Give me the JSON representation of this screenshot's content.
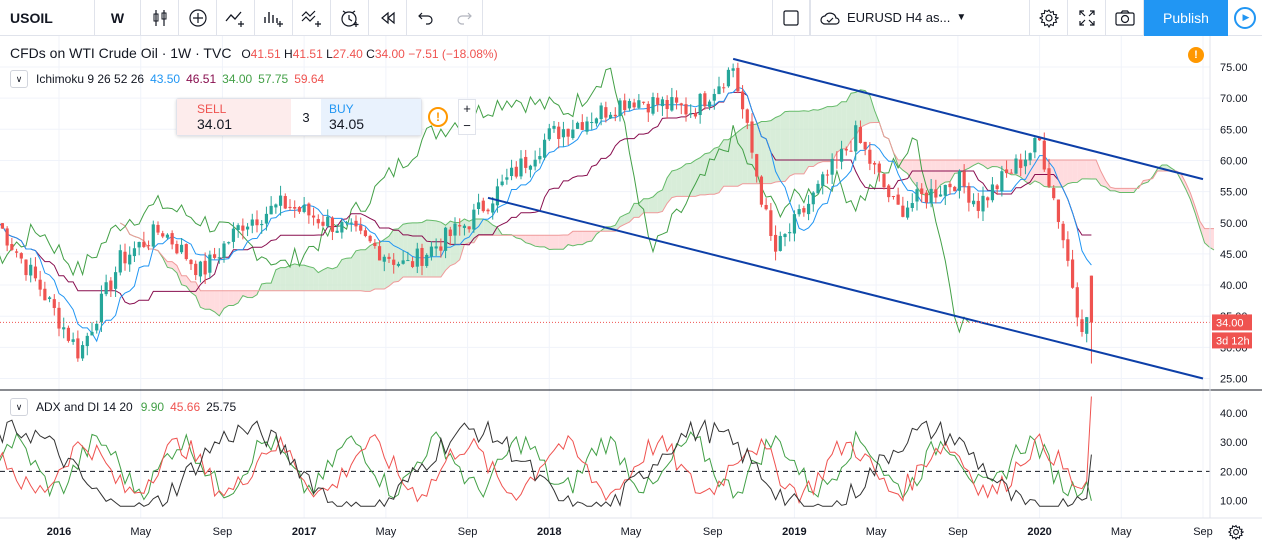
{
  "toolbar": {
    "symbol": "USOIL",
    "interval": "W",
    "icons": [
      "candles-icon",
      "add-compare-icon",
      "indicators-icon",
      "templates-icon",
      "drawing-templates-icon",
      "alert-icon",
      "replay-icon",
      "undo-icon",
      "redo-icon"
    ],
    "layout_name": "EURUSD H4 as...",
    "publish_label": "Publish"
  },
  "legend": {
    "title": "CFDs on WTI Crude Oil · 1W · TVC",
    "ohlc": {
      "o_label": "O",
      "o": "41.51",
      "h_label": "H",
      "h": "41.51",
      "l_label": "L",
      "l": "27.40",
      "c_label": "C",
      "c": "34.00",
      "change": "−7.51 (−18.08%)"
    }
  },
  "indicators": {
    "ichimoku": {
      "name": "Ichimoku 9 26 52 26",
      "v1": "43.50",
      "v2": "46.51",
      "v3": "34.00",
      "v4": "57.75",
      "v5": "59.64"
    },
    "adx": {
      "name": "ADX and DI 14 20",
      "v1": "9.90",
      "v2": "45.66",
      "v3": "25.75"
    }
  },
  "trade": {
    "sell_label": "SELL",
    "sell_price": "34.01",
    "qty": "3",
    "buy_label": "BUY",
    "buy_price": "34.05"
  },
  "price_axis": {
    "labels": [
      "75.00",
      "70.00",
      "65.00",
      "60.00",
      "55.00",
      "50.00",
      "45.00",
      "40.00",
      "35.00",
      "30.00",
      "25.00"
    ],
    "current_price": "34.00",
    "countdown": "3d 12h"
  },
  "adx_axis": {
    "labels": [
      "40.00",
      "30.00",
      "20.00",
      "10.00"
    ],
    "threshold": 20
  },
  "time_axis": {
    "labels": [
      "2016",
      "May",
      "Sep",
      "2017",
      "May",
      "Sep",
      "2018",
      "May",
      "Sep",
      "2019",
      "May",
      "Sep",
      "2020",
      "May",
      "Sep"
    ],
    "bold": [
      true,
      false,
      false,
      true,
      false,
      false,
      true,
      false,
      false,
      true,
      false,
      false,
      true,
      false,
      false
    ]
  },
  "colors": {
    "up": "#26a69a",
    "down": "#ef5350",
    "tenkan": "#2196f3",
    "kijun": "#880e4f",
    "chikou": "#43a047",
    "cloud_up": "#c8e6c9",
    "cloud_down": "#ffcdd2",
    "trendline": "#0d3fa8",
    "adx": "#333333",
    "di_plus": "#43a047",
    "di_minus": "#ef5350",
    "publish": "#2196f3"
  },
  "chart_data": {
    "type": "candlestick",
    "title": "CFDs on WTI Crude Oil · 1W · TVC",
    "ylim": [
      25,
      75
    ],
    "x_range": [
      "2015-10",
      "2020-09"
    ],
    "keypoints": [
      [
        "2015-10",
        50
      ],
      [
        "2015-12",
        40
      ],
      [
        "2016-02",
        29
      ],
      [
        "2016-04",
        44
      ],
      [
        "2016-06",
        49
      ],
      [
        "2016-08",
        42
      ],
      [
        "2016-10",
        50
      ],
      [
        "2016-12",
        53
      ],
      [
        "2017-03",
        49
      ],
      [
        "2017-06",
        43
      ],
      [
        "2017-09",
        50
      ],
      [
        "2017-11",
        57
      ],
      [
        "2018-01",
        64
      ],
      [
        "2018-05",
        70
      ],
      [
        "2018-08",
        68
      ],
      [
        "2018-10",
        75
      ],
      [
        "2018-12",
        45
      ],
      [
        "2019-04",
        64
      ],
      [
        "2019-06",
        52
      ],
      [
        "2019-09",
        57
      ],
      [
        "2019-10",
        53
      ],
      [
        "2020-01",
        63
      ],
      [
        "2020-02",
        50
      ],
      [
        "2020-03",
        34
      ]
    ],
    "trendlines": [
      {
        "from": [
          "2018-10",
          76.3
        ],
        "to": [
          "2020-09",
          57.0
        ]
      },
      {
        "from": [
          "2017-10",
          54.0
        ],
        "to": [
          "2020-09",
          25.0
        ]
      }
    ],
    "adx_ylim": [
      5,
      47
    ]
  }
}
